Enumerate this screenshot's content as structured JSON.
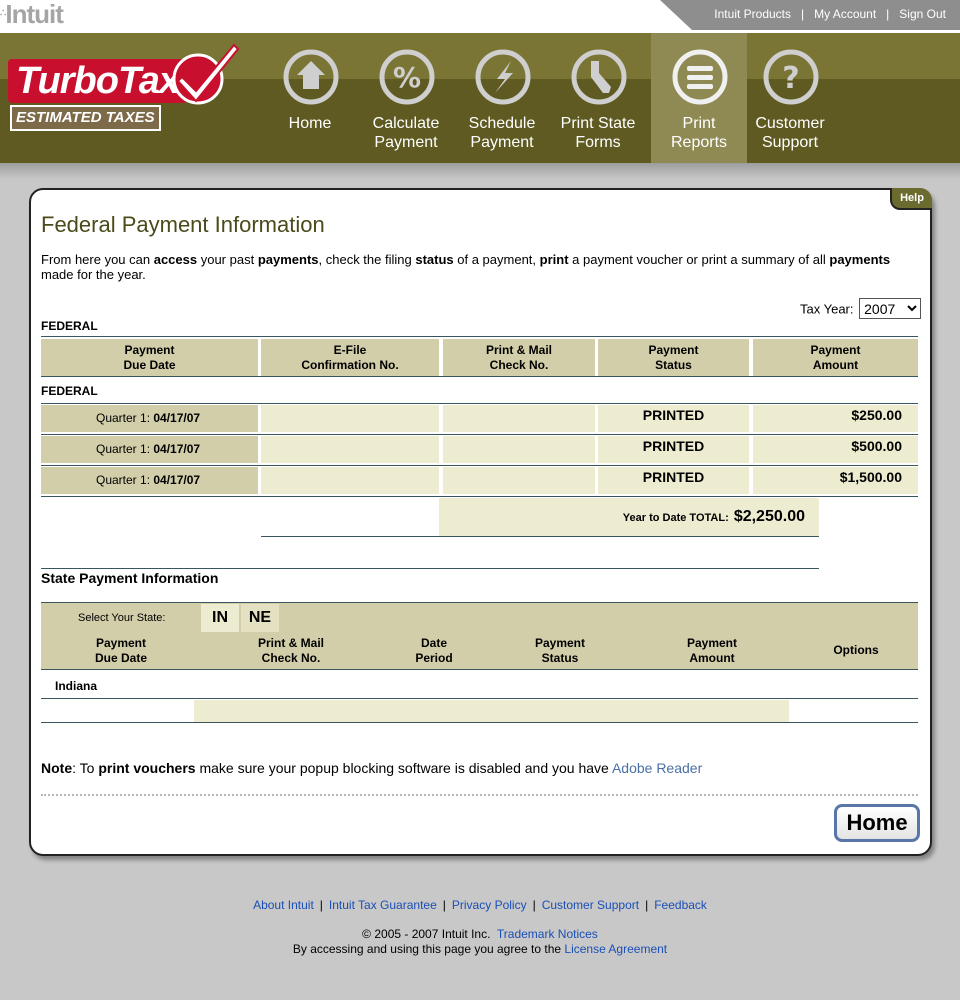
{
  "top": {
    "logo": "Intuit",
    "links": [
      "Intuit Products",
      "My Account",
      "Sign Out"
    ]
  },
  "brand": {
    "name": "TurboTax",
    "sub": "ESTIMATED TAXES"
  },
  "nav": [
    {
      "icon": "home-icon",
      "line1": "Home",
      "line2": ""
    },
    {
      "icon": "percent-icon",
      "line1": "Calculate",
      "line2": "Payment"
    },
    {
      "icon": "lightning-icon",
      "line1": "Schedule",
      "line2": "Payment"
    },
    {
      "icon": "state-map-icon",
      "line1": "Print State",
      "line2": "Forms"
    },
    {
      "icon": "list-icon",
      "line1": "Print",
      "line2": "Reports",
      "active": true
    },
    {
      "icon": "question-icon",
      "line1": "Customer",
      "line2": "Support"
    }
  ],
  "panel": {
    "help": "Help",
    "title": "Federal Payment Information",
    "intro": {
      "p1": "From here you can ",
      "b1": "access",
      "p2": " your past ",
      "b2": "payments",
      "p3": ", check the filing ",
      "b3": "status",
      "p4": " of a payment, ",
      "b4": "print",
      "p5": " a payment voucher or print a summary of all ",
      "b5": "payments",
      "p6": " made for the year."
    },
    "tax_year_label": "Tax Year:",
    "tax_year_value": "2007",
    "federal_label": "FEDERAL",
    "federal_head": [
      {
        "l1": "Payment",
        "l2": "Due Date"
      },
      {
        "l1": "E-File",
        "l2": "Confirmation No."
      },
      {
        "l1": "Print & Mail",
        "l2": "Check No."
      },
      {
        "l1": "Payment",
        "l2": "Status"
      },
      {
        "l1": "Payment",
        "l2": "Amount"
      }
    ],
    "federal_rows": [
      {
        "quarter": "Quarter 1: ",
        "date": "04/17/07",
        "status": "PRINTED",
        "amount": "$250.00"
      },
      {
        "quarter": "Quarter 1: ",
        "date": "04/17/07",
        "status": "PRINTED",
        "amount": "$500.00"
      },
      {
        "quarter": "Quarter 1: ",
        "date": "04/17/07",
        "status": "PRINTED",
        "amount": "$1,500.00"
      }
    ],
    "total_label": "Year to Date TOTAL:",
    "total_amount": "$2,250.00",
    "state_title": "State Payment Information",
    "select_state_label": "Select Your State:",
    "states": [
      "IN",
      "NE"
    ],
    "state_head": [
      {
        "l1": "Payment",
        "l2": "Due Date"
      },
      {
        "l1": "Print & Mail",
        "l2": "Check No."
      },
      {
        "l1": "Date",
        "l2": "Period"
      },
      {
        "l1": "Payment",
        "l2": "Status"
      },
      {
        "l1": "Payment",
        "l2": "Amount"
      },
      {
        "l1": "Options",
        "l2": ""
      }
    ],
    "state_name": "Indiana",
    "note": {
      "b1": "Note",
      "p1": ": To ",
      "b2": "print vouchers",
      "p2": " make sure your popup blocking software is disabled and you have ",
      "link": "Adobe Reader"
    },
    "home_button": "Home"
  },
  "footer": {
    "links": [
      "About Intuit",
      "Intuit Tax Guarantee",
      "Privacy Policy",
      "Customer Support",
      "Feedback"
    ],
    "copyright": "© 2005 - 2007 Intuit Inc.",
    "trademark": "Trademark Notices",
    "agree": "By accessing and using this page you agree to the ",
    "license": "License Agreement"
  },
  "colors": {
    "header_dark": "#5e5a21",
    "header_band": "#7a7535",
    "cell_dark": "#d2ceaa",
    "cell_light": "#eeecd0",
    "link_blue": "#1a4fb5"
  }
}
